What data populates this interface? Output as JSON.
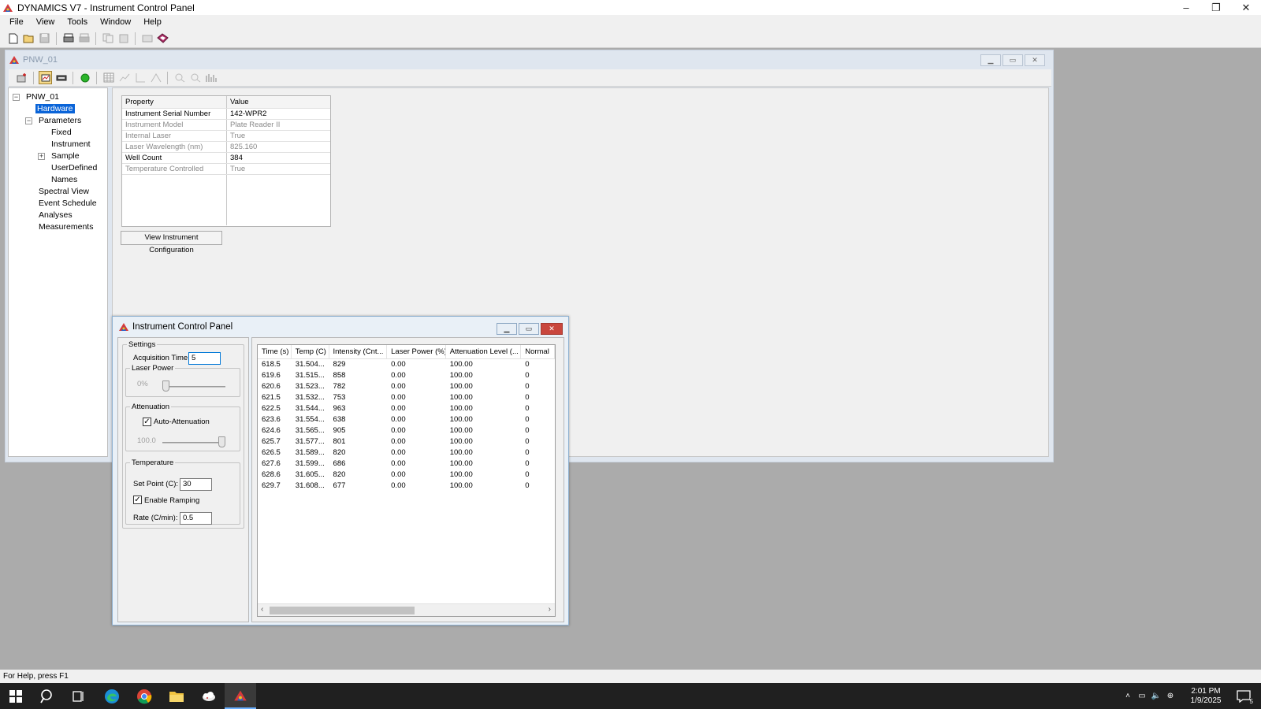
{
  "app": {
    "title": "DYNAMICS V7 - Instrument Control Panel",
    "window_controls": [
      "–",
      "❐",
      "✕"
    ]
  },
  "menu": [
    "File",
    "View",
    "Tools",
    "Window",
    "Help"
  ],
  "child_window": {
    "title": "PNW_01"
  },
  "tree": {
    "items": [
      {
        "label": "PNW_01",
        "level": 0,
        "expander": "minus"
      },
      {
        "label": "Hardware",
        "level": 1,
        "selected": true
      },
      {
        "label": "Parameters",
        "level": 1,
        "expander": "minus"
      },
      {
        "label": "Fixed",
        "level": 2
      },
      {
        "label": "Instrument",
        "level": 2
      },
      {
        "label": "Sample",
        "level": 2,
        "expander": "plus"
      },
      {
        "label": "UserDefined",
        "level": 2
      },
      {
        "label": "Names",
        "level": 2
      },
      {
        "label": "Spectral View",
        "level": 1
      },
      {
        "label": "Event Schedule",
        "level": 1
      },
      {
        "label": "Analyses",
        "level": 1
      },
      {
        "label": "Measurements",
        "level": 1
      }
    ]
  },
  "properties": {
    "headers": [
      "Property",
      "Value"
    ],
    "rows": [
      {
        "property": "Instrument Serial Number",
        "value": "142-WPR2",
        "editable": true
      },
      {
        "property": "Instrument Model",
        "value": "Plate Reader II",
        "editable": false
      },
      {
        "property": "Internal Laser",
        "value": "True",
        "editable": false
      },
      {
        "property": "Laser Wavelength (nm)",
        "value": "825.160",
        "editable": false
      },
      {
        "property": "Well Count",
        "value": "384",
        "editable": true
      },
      {
        "property": "Temperature Controlled",
        "value": "True",
        "editable": false
      }
    ]
  },
  "view_config_button": "View Instrument Configuration",
  "control_panel": {
    "title": "Instrument Control Panel",
    "settings": {
      "group_label": "Settings",
      "acquisition_label": "Acquisition Time:",
      "acquisition_value": "5",
      "laser_power_label": "Laser Power",
      "laser_power_value": "0%",
      "laser_power_level": 0,
      "attenuation_label": "Attenuation",
      "auto_attenuation_label": "Auto-Attenuation",
      "auto_attenuation_checked": true,
      "attenuation_value": "100.0",
      "attenuation_level": 1.0,
      "temperature_label": "Temperature",
      "setpoint_label": "Set Point (C):",
      "setpoint_value": "30",
      "enable_ramping_label": "Enable Ramping",
      "enable_ramping_checked": true,
      "rate_label": "Rate (C/min):",
      "rate_value": "0.5"
    },
    "table": {
      "headers": [
        "Time (s)",
        "Temp (C)",
        "Intensity (Cnt...",
        "Laser Power (%)",
        "Attenuation Level (...",
        "Normal"
      ],
      "rows": [
        [
          "618.5",
          "31.504...",
          "829",
          "0.00",
          "100.00",
          "0"
        ],
        [
          "619.6",
          "31.515...",
          "858",
          "0.00",
          "100.00",
          "0"
        ],
        [
          "620.6",
          "31.523...",
          "782",
          "0.00",
          "100.00",
          "0"
        ],
        [
          "621.5",
          "31.532...",
          "753",
          "0.00",
          "100.00",
          "0"
        ],
        [
          "622.5",
          "31.544...",
          "963",
          "0.00",
          "100.00",
          "0"
        ],
        [
          "623.6",
          "31.554...",
          "638",
          "0.00",
          "100.00",
          "0"
        ],
        [
          "624.6",
          "31.565...",
          "905",
          "0.00",
          "100.00",
          "0"
        ],
        [
          "625.7",
          "31.577...",
          "801",
          "0.00",
          "100.00",
          "0"
        ],
        [
          "626.5",
          "31.589...",
          "820",
          "0.00",
          "100.00",
          "0"
        ],
        [
          "627.6",
          "31.599...",
          "686",
          "0.00",
          "100.00",
          "0"
        ],
        [
          "628.6",
          "31.605...",
          "820",
          "0.00",
          "100.00",
          "0"
        ],
        [
          "629.7",
          "31.608...",
          "677",
          "0.00",
          "100.00",
          "0"
        ]
      ]
    }
  },
  "status_bar": "For Help, press F1",
  "taskbar": {
    "time": "2:01 PM",
    "date": "1/9/2025",
    "notification_count": "5"
  }
}
